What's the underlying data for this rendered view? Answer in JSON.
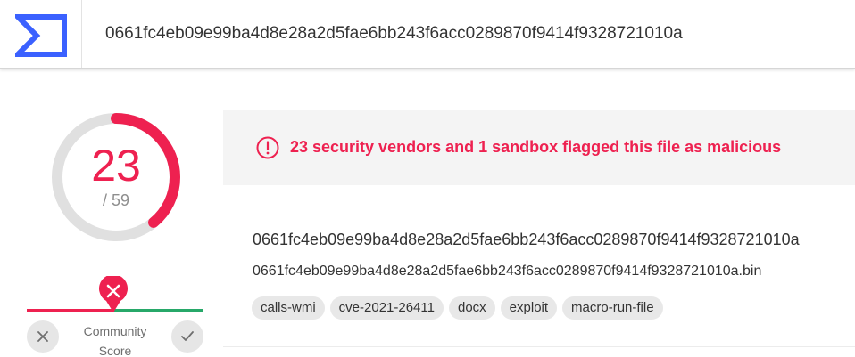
{
  "search": {
    "value": "0661fc4eb09e99ba4d8e28a2d5fae6bb243f6acc0289870f9414f9328721010a"
  },
  "score": {
    "detections": "23",
    "total": "/ 59",
    "ratio": 0.39
  },
  "community": {
    "label": "Community Score",
    "down_icon": "close-icon",
    "up_icon": "check-icon",
    "marker_icon": "close-icon"
  },
  "alert": {
    "icon": "exclamation-circle-icon",
    "text": "23 security vendors and 1 sandbox flagged this file as malicious"
  },
  "file": {
    "hash": "0661fc4eb09e99ba4d8e28a2d5fae6bb243f6acc0289870f9414f9328721010a",
    "name": "0661fc4eb09e99ba4d8e28a2d5fae6bb243f6acc0289870f9414f9328721010a.bin",
    "tags": [
      "calls-wmi",
      "cve-2021-26411",
      "docx",
      "exploit",
      "macro-run-file"
    ]
  },
  "colors": {
    "malicious": "#ee2150",
    "harmless": "#27a869",
    "brand": "#3b61ff"
  }
}
